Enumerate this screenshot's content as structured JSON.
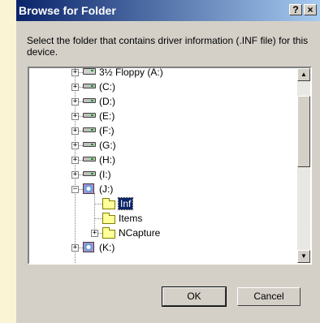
{
  "window": {
    "title": "Browse for Folder",
    "help_glyph": "?",
    "close_glyph": "×"
  },
  "description": "Select the folder that contains driver information (.INF file) for this device.",
  "tree": [
    {
      "label": "3½ Floppy (A:)",
      "icon": "floppy-drive-icon",
      "expander": "+",
      "level": 1
    },
    {
      "label": "(C:)",
      "icon": "hard-drive-icon",
      "expander": "+",
      "level": 1
    },
    {
      "label": "(D:)",
      "icon": "hard-drive-icon",
      "expander": "+",
      "level": 1
    },
    {
      "label": "(E:)",
      "icon": "hard-drive-icon",
      "expander": "+",
      "level": 1
    },
    {
      "label": "(F:)",
      "icon": "hard-drive-icon",
      "expander": "+",
      "level": 1
    },
    {
      "label": "(G:)",
      "icon": "hard-drive-icon",
      "expander": "+",
      "level": 1
    },
    {
      "label": "(H:)",
      "icon": "hard-drive-icon",
      "expander": "+",
      "level": 1
    },
    {
      "label": "(I:)",
      "icon": "hard-drive-icon",
      "expander": "+",
      "level": 1
    },
    {
      "label": "(J:)",
      "icon": "cd-drive-icon",
      "expander": "−",
      "level": 1
    },
    {
      "label": "Inf",
      "icon": "open-folder-icon",
      "expander": "",
      "level": 2,
      "selected": true
    },
    {
      "label": "Items",
      "icon": "folder-icon",
      "expander": "",
      "level": 2
    },
    {
      "label": "NCapture",
      "icon": "folder-icon",
      "expander": "+",
      "level": 2
    },
    {
      "label": "(K:)",
      "icon": "cd-drive-icon",
      "expander": "+",
      "level": 1
    }
  ],
  "scroll": {
    "up_glyph": "▲",
    "down_glyph": "▼"
  },
  "buttons": {
    "ok": "OK",
    "cancel": "Cancel"
  }
}
